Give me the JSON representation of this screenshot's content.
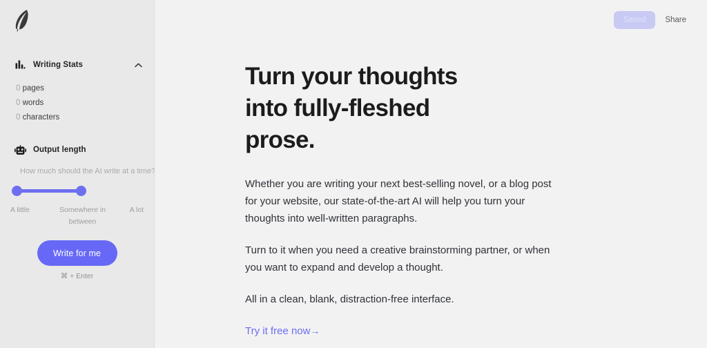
{
  "sidebar": {
    "logo_icon": "feather-quill-logo",
    "writing_stats": {
      "icon": "bar-chart-icon",
      "title": "Writing Stats",
      "collapse_icon": "chevron-up-icon",
      "rows": [
        {
          "value": "0",
          "label": "pages"
        },
        {
          "value": "0",
          "label": "words"
        },
        {
          "value": "0",
          "label": "characters"
        }
      ]
    },
    "output_length": {
      "icon": "robot-icon",
      "title": "Output length",
      "helper": "How much should the AI write at a time?",
      "slider": {
        "labels": [
          "A little",
          "Somewhere in between",
          "A lot"
        ],
        "min_label": "A little",
        "mid_label": "Somewhere in between",
        "max_label": "A lot",
        "fill_color": "#6e6ef0"
      },
      "write_button": "Write for me",
      "shortcut": "⌘ + Enter"
    }
  },
  "topbar": {
    "saved_label": "Saved",
    "share_label": "Share",
    "saved_bg": "#c8caf4",
    "saved_fg": "#e2e3fb"
  },
  "document": {
    "heading_line1": "Turn your thoughts",
    "heading_line2": "into fully-fleshed",
    "heading_line3": "prose.",
    "paragraph1": "Whether you are writing your next best-selling novel, or a blog post for your website, our state-of-the-art AI will help you turn your thoughts into well-written paragraphs.",
    "paragraph2": "Turn to it when you need a creative brainstorming partner, or when you want to expand and develop a thought.",
    "paragraph3": "All in a clean, blank, distraction-free interface.",
    "link_text": "Try it free now",
    "link_arrow": "→",
    "link_color": "#6c6ef2"
  }
}
